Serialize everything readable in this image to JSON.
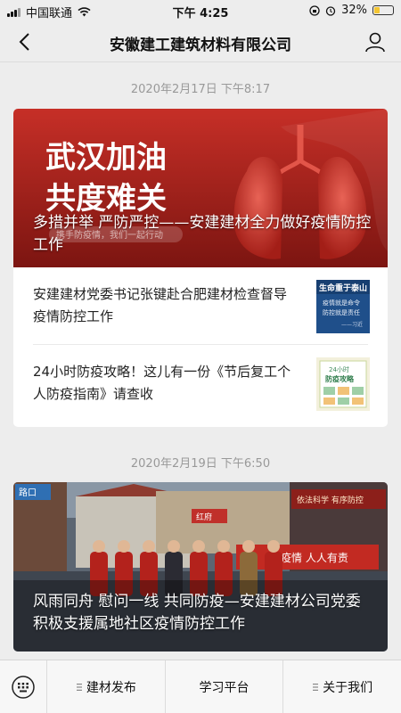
{
  "status_bar": {
    "carrier": "中国联通",
    "time": "下午 4:25",
    "battery": "32%",
    "battery_level": 0.32
  },
  "nav": {
    "title": "安徽建工建筑材料有限公司"
  },
  "groups": [
    {
      "timestamp": "2020年2月17日 下午8:17",
      "hero": {
        "banner_line1": "武汉加油",
        "banner_line2": "共度难关",
        "banner_tag": "携手防疫情，我们一起行动",
        "caption": "多措并举 严防严控——安建建材全力做好疫情防控工作"
      },
      "items": [
        {
          "text": "安建建材党委书记张键赴合肥建材检查督导疫情防控工作",
          "thumb_line1": "生命重于泰山",
          "thumb_line2": "疫情就是命令",
          "thumb_line3": "防控就是责任",
          "thumb_line4": "——习近"
        },
        {
          "text": "24小时防疫攻略！这儿有一份《节后复工个人防疫指南》请查收",
          "thumb_line1": "24小时",
          "thumb_line2": "防疫攻略"
        }
      ]
    },
    {
      "timestamp": "2020年2月19日 下午6:50",
      "hero": {
        "sign_left": "路口",
        "sign_mid": "红府",
        "sign_right": "依法科学 有序防控",
        "banner_text": "疫情 人人有责",
        "caption": "风雨同舟 慰问一线 共同防疫—安建建材公司党委积极支援属地社区疫情防控工作"
      }
    }
  ],
  "tab_bar": {
    "tabs": [
      {
        "label": "建材发布",
        "has_menu": true
      },
      {
        "label": "学习平台",
        "has_menu": false
      },
      {
        "label": "关于我们",
        "has_menu": true
      }
    ]
  },
  "colors": {
    "accent_red": "#b8251f",
    "background": "#ededed",
    "battery_fill": "#f4c531"
  }
}
